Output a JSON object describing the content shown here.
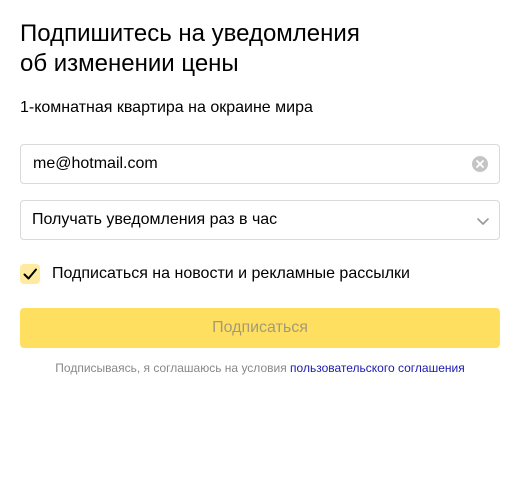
{
  "header": {
    "title_line1": "Подпишитесь на уведомления",
    "title_line2": "об изменении цены",
    "subtitle": "1-комнатная квартира на окраине мира"
  },
  "form": {
    "email_value": "me@hotmail.com",
    "email_placeholder": "",
    "frequency_selected": "Получать уведомления раз в час",
    "newsletter_label": "Подписаться на новости и рекламные рассылки",
    "newsletter_checked": true,
    "submit_label": "Подписаться"
  },
  "footer": {
    "agreement_prefix": "Подписываясь, я соглашаюсь на условия",
    "agreement_link": "пользовательского соглашения"
  },
  "icons": {
    "clear": "clear-circle-icon",
    "chevron": "chevron-down-icon",
    "check": "checkmark-icon"
  },
  "colors": {
    "accent": "#ffdf60",
    "checkbox_bg": "#ffeba0",
    "link": "#1a1ab0",
    "muted_text": "#888888",
    "border": "#d9d9d9"
  }
}
